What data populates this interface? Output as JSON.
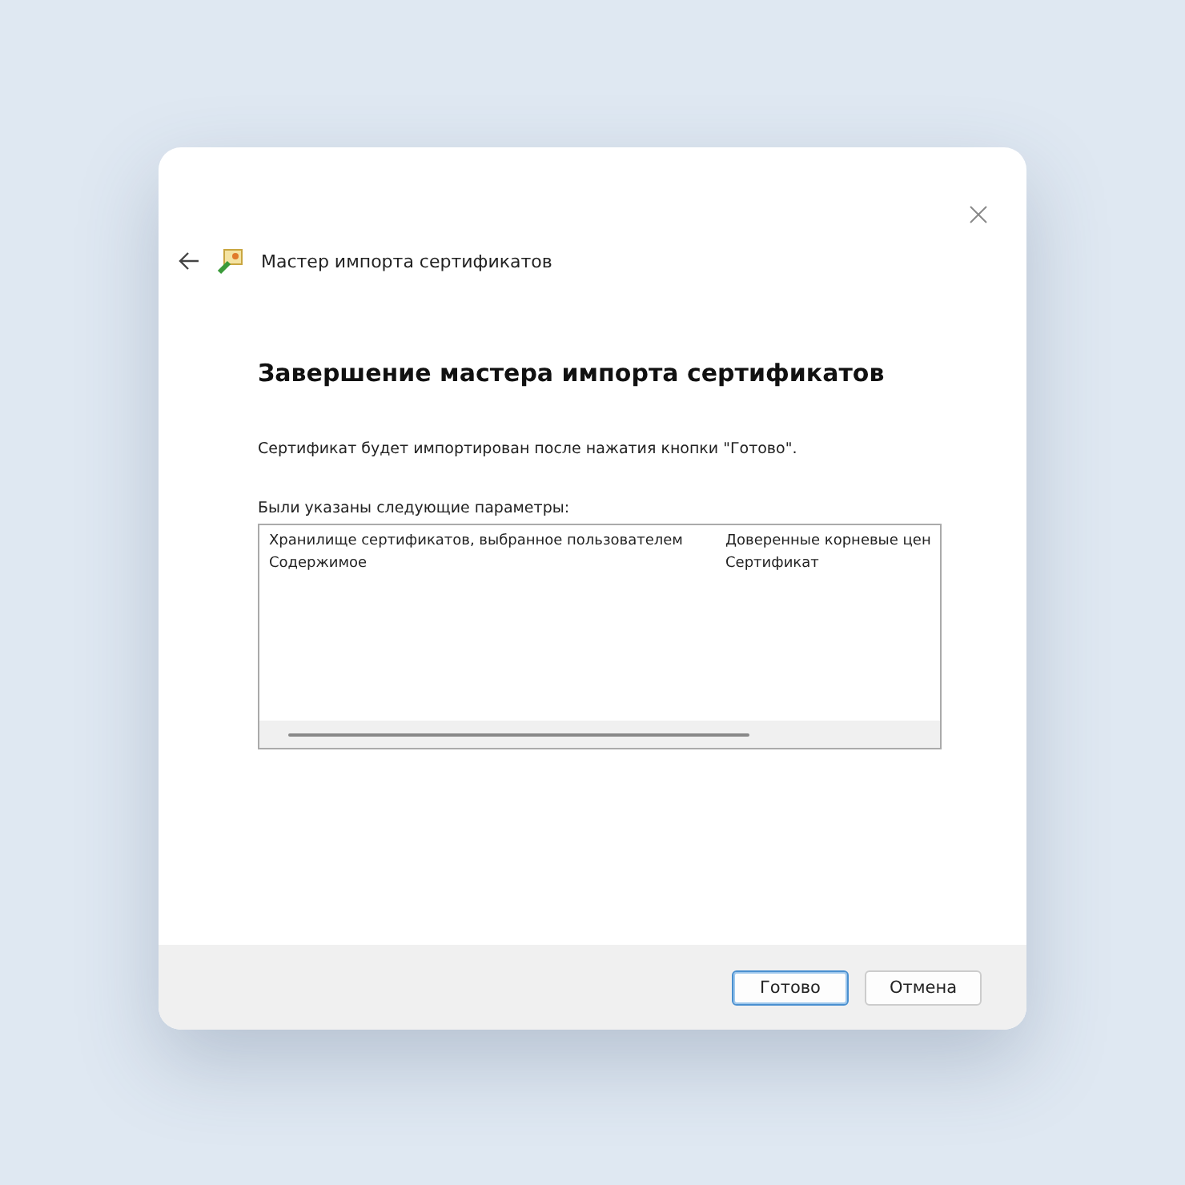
{
  "window": {
    "title": "Мастер импорта сертификатов"
  },
  "heading": "Завершение мастера импорта сертификатов",
  "description": "Сертификат будет импортирован после нажатия кнопки \"Готово\".",
  "list_label": "Были указаны следующие параметры:",
  "settings": [
    {
      "name": "Хранилище сертификатов, выбранное пользователем",
      "value": "Доверенные корневые цен"
    },
    {
      "name": "Содержимое",
      "value": "Сертификат"
    }
  ],
  "buttons": [
    {
      "label": "Готово",
      "default": true
    },
    {
      "label": "Отмена",
      "default": false
    }
  ]
}
